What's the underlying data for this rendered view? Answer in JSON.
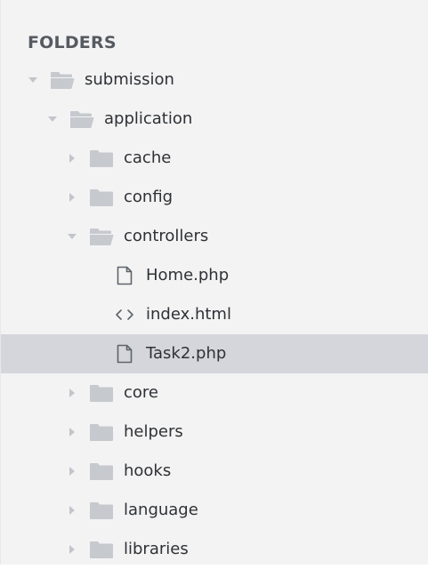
{
  "sidebar": {
    "header": "FOLDERS",
    "rows": [
      {
        "label": "submission",
        "type": "folder",
        "state": "open",
        "level": 0,
        "icon": "folder-open-icon"
      },
      {
        "label": "application",
        "type": "folder",
        "state": "open",
        "level": 1,
        "icon": "folder-open-icon"
      },
      {
        "label": "cache",
        "type": "folder",
        "state": "closed",
        "level": 2,
        "icon": "folder-icon"
      },
      {
        "label": "config",
        "type": "folder",
        "state": "closed",
        "level": 2,
        "icon": "folder-icon"
      },
      {
        "label": "controllers",
        "type": "folder",
        "state": "open",
        "level": 2,
        "icon": "folder-open-icon"
      },
      {
        "label": "Home.php",
        "type": "file",
        "level": 3,
        "icon": "file-icon"
      },
      {
        "label": "index.html",
        "type": "file",
        "level": 3,
        "icon": "code-file-icon"
      },
      {
        "label": "Task2.php",
        "type": "file",
        "level": 3,
        "icon": "file-icon",
        "selected": true
      },
      {
        "label": "core",
        "type": "folder",
        "state": "closed",
        "level": 2,
        "icon": "folder-icon"
      },
      {
        "label": "helpers",
        "type": "folder",
        "state": "closed",
        "level": 2,
        "icon": "folder-icon"
      },
      {
        "label": "hooks",
        "type": "folder",
        "state": "closed",
        "level": 2,
        "icon": "folder-icon"
      },
      {
        "label": "language",
        "type": "folder",
        "state": "closed",
        "level": 2,
        "icon": "folder-icon"
      },
      {
        "label": "libraries",
        "type": "folder",
        "state": "closed",
        "level": 2,
        "icon": "folder-icon"
      }
    ]
  },
  "colors": {
    "background": "#f3f3f3",
    "selected_row": "#d4d6db",
    "text": "#2e3135",
    "header": "#555b61",
    "disclosure": "#c2c6cb",
    "folder_icon": "#c6c9cd",
    "file_icon": "#5d646b"
  }
}
